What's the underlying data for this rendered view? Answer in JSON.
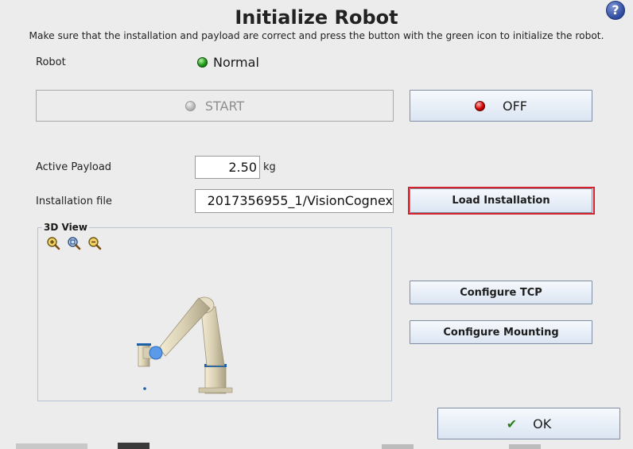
{
  "header": {
    "title": "Initialize Robot",
    "subtitle": "Make sure that the installation and payload are correct and press the button with the green icon to initialize the robot.",
    "help_label": "?"
  },
  "robot": {
    "label": "Robot",
    "status": "Normal",
    "status_color": "#1f9a1a"
  },
  "buttons": {
    "start": "START",
    "off": "OFF",
    "load_installation": "Load Installation",
    "configure_tcp": "Configure TCP",
    "configure_mounting": "Configure Mounting",
    "ok": "OK"
  },
  "payload": {
    "label": "Active Payload",
    "value": "2.50",
    "unit": "kg"
  },
  "installation": {
    "label": "Installation file",
    "value": "2017356955_1/VisionCognex"
  },
  "view3d": {
    "label": "3D View",
    "zoom_tools": [
      "zoom-in-icon",
      "zoom-fit-icon",
      "zoom-out-icon"
    ]
  },
  "colors": {
    "highlight": "#d6232b",
    "accent_ok": "#2f7d1f",
    "robot_body": "#d8cfb2",
    "robot_joint": "#1d5fa6"
  }
}
